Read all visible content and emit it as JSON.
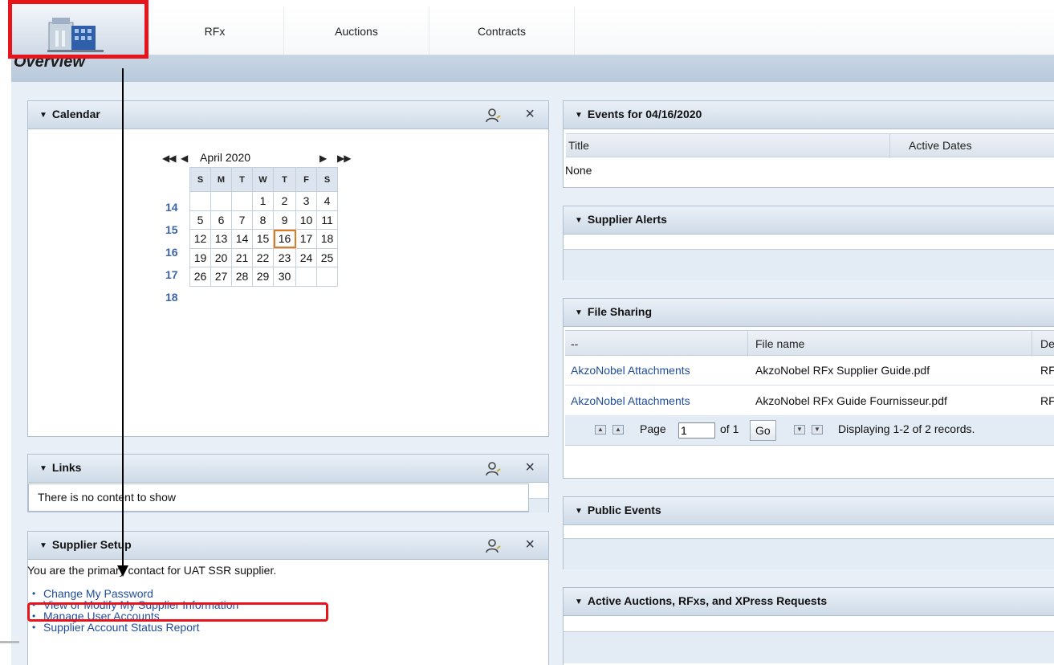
{
  "nav": {
    "tabs": [
      {
        "label": "RFx"
      },
      {
        "label": "Auctions"
      },
      {
        "label": "Contracts"
      }
    ]
  },
  "overview": {
    "title": "Overview"
  },
  "calendar": {
    "title": "Calendar",
    "month": "April 2020",
    "nav": {
      "first": "◀◀",
      "prev": "◀",
      "next": "▶",
      "last": "▶▶"
    },
    "weekdays": [
      "S",
      "M",
      "T",
      "W",
      "T",
      "F",
      "S"
    ],
    "weeks": [
      {
        "num": "14",
        "days": [
          "",
          "",
          "",
          "1",
          "2",
          "3",
          "4"
        ]
      },
      {
        "num": "15",
        "days": [
          "5",
          "6",
          "7",
          "8",
          "9",
          "10",
          "11"
        ]
      },
      {
        "num": "16",
        "days": [
          "12",
          "13",
          "14",
          "15",
          "16",
          "17",
          "18"
        ]
      },
      {
        "num": "17",
        "days": [
          "19",
          "20",
          "21",
          "22",
          "23",
          "24",
          "25"
        ]
      },
      {
        "num": "18",
        "days": [
          "26",
          "27",
          "28",
          "29",
          "30",
          "",
          ""
        ]
      }
    ],
    "today": "16"
  },
  "links": {
    "title": "Links",
    "empty_text": "There is no content to show"
  },
  "supplier_setup": {
    "title": "Supplier Setup",
    "intro": "You are the primary contact for UAT SSR supplier.",
    "items": [
      {
        "label": "Change My Password"
      },
      {
        "label": "View or Modify My Supplier Information"
      },
      {
        "label": "Manage User Accounts"
      },
      {
        "label": "Supplier Account Status Report"
      }
    ]
  },
  "events": {
    "title": "Events for 04/16/2020",
    "columns": [
      "Title",
      "Active Dates"
    ],
    "empty_text": "None"
  },
  "supplier_alerts": {
    "title": "Supplier Alerts"
  },
  "file_sharing": {
    "title": "File Sharing",
    "columns": [
      "--",
      "File name",
      "De"
    ],
    "rows": [
      {
        "source": "AkzoNobel Attachments",
        "file": "AkzoNobel RFx Supplier Guide.pdf",
        "desc": "RF"
      },
      {
        "source": "AkzoNobel Attachments",
        "file": "AkzoNobel RFx Guide Fournisseur.pdf",
        "desc": "RF"
      }
    ],
    "pager": {
      "page_label": "Page",
      "page_value": "1",
      "of_label": "of 1",
      "go_label": "Go",
      "status": "Displaying 1-2 of 2 records."
    }
  },
  "public_events": {
    "title": "Public Events"
  },
  "active_auctions": {
    "title": "Active Auctions, RFxs, and XPress Requests"
  },
  "colors": {
    "accent": "#1f4d9c",
    "annotation": "#e8141b",
    "today_outline": "#e07a1f"
  },
  "icons": {
    "home": "building-icon",
    "person": "person-settings-icon",
    "close": "close-icon",
    "collapse": "triangle-down-icon"
  }
}
